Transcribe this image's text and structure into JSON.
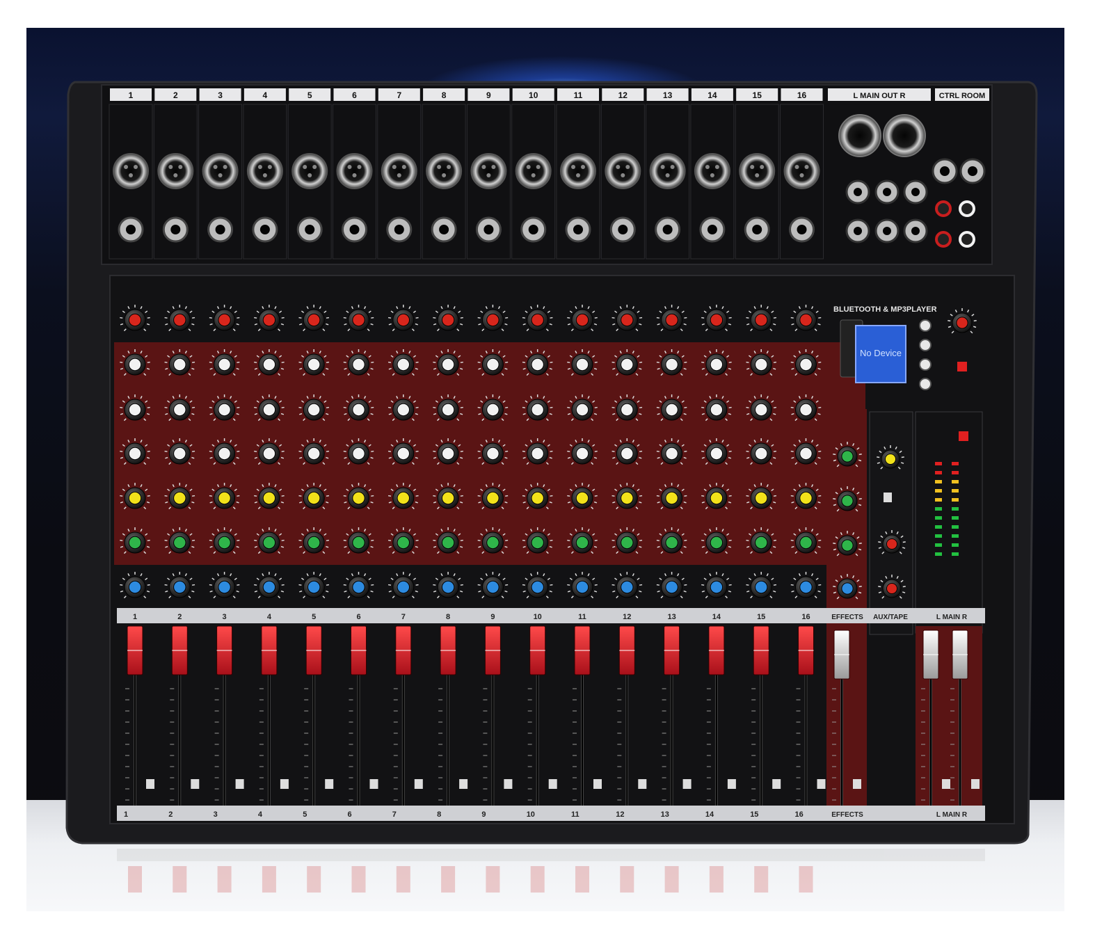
{
  "channels": [
    "1",
    "2",
    "3",
    "4",
    "5",
    "6",
    "7",
    "8",
    "9",
    "10",
    "11",
    "12",
    "13",
    "14",
    "15",
    "16"
  ],
  "output_labels": {
    "main_out": "L MAIN OUT R",
    "ctrl_room": "CTRL ROOM",
    "effects": "EFFECTS",
    "aux_tape": "AUX/TAPE",
    "main_lr": "L MAIN R"
  },
  "player": {
    "title": "BLUETOOTH & MP3PLAYER",
    "display_text": "No Device"
  },
  "colors": {
    "panel": "#141416",
    "eq_strip": "#5a1414",
    "gain_knob": "#d8261c",
    "eq_knob": "#f2f2f2",
    "aux_knob": "#f2e21a",
    "fx_knob": "#2fb54a",
    "pan_knob": "#2d8be0",
    "fader_cap": "#e0222a",
    "lcd": "#2a5fd6"
  }
}
